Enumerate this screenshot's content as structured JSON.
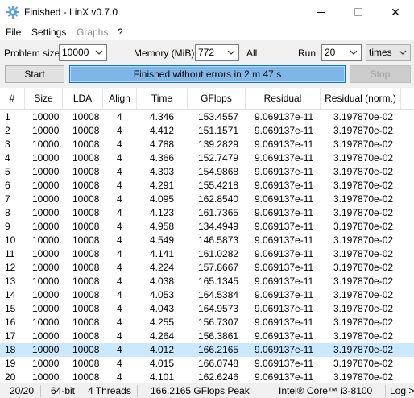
{
  "window": {
    "title": "Finished - LinX v0.7.0",
    "close_glyph": "✕"
  },
  "menu": {
    "file": "File",
    "settings": "Settings",
    "graphs": "Graphs",
    "help": "?"
  },
  "controls": {
    "problem_size_label": "Problem size:",
    "problem_size_value": "10000",
    "memory_label": "Memory (MiB):",
    "memory_value": "772",
    "all_label": "All",
    "run_label": "Run:",
    "run_value": "20",
    "run_unit": "times",
    "start_button": "Start",
    "stop_button": "Stop",
    "progress_text": "Finished without errors in 2 m 47 s",
    "progress_fraction": 1.0
  },
  "table": {
    "columns": [
      "#",
      "Size",
      "LDA",
      "Align",
      "Time",
      "GFlops",
      "Residual",
      "Residual (norm.)"
    ],
    "selected_row_index": 17,
    "rows": [
      [
        "1",
        "10000",
        "10008",
        "4",
        "4.346",
        "153.4557",
        "9.069137e-11",
        "3.197870e-02"
      ],
      [
        "2",
        "10000",
        "10008",
        "4",
        "4.412",
        "151.1571",
        "9.069137e-11",
        "3.197870e-02"
      ],
      [
        "3",
        "10000",
        "10008",
        "4",
        "4.788",
        "139.2829",
        "9.069137e-11",
        "3.197870e-02"
      ],
      [
        "4",
        "10000",
        "10008",
        "4",
        "4.366",
        "152.7479",
        "9.069137e-11",
        "3.197870e-02"
      ],
      [
        "5",
        "10000",
        "10008",
        "4",
        "4.303",
        "154.9868",
        "9.069137e-11",
        "3.197870e-02"
      ],
      [
        "6",
        "10000",
        "10008",
        "4",
        "4.291",
        "155.4218",
        "9.069137e-11",
        "3.197870e-02"
      ],
      [
        "7",
        "10000",
        "10008",
        "4",
        "4.095",
        "162.8540",
        "9.069137e-11",
        "3.197870e-02"
      ],
      [
        "8",
        "10000",
        "10008",
        "4",
        "4.123",
        "161.7365",
        "9.069137e-11",
        "3.197870e-02"
      ],
      [
        "9",
        "10000",
        "10008",
        "4",
        "4.958",
        "134.4949",
        "9.069137e-11",
        "3.197870e-02"
      ],
      [
        "10",
        "10000",
        "10008",
        "4",
        "4.549",
        "146.5873",
        "9.069137e-11",
        "3.197870e-02"
      ],
      [
        "11",
        "10000",
        "10008",
        "4",
        "4.141",
        "161.0282",
        "9.069137e-11",
        "3.197870e-02"
      ],
      [
        "12",
        "10000",
        "10008",
        "4",
        "4.224",
        "157.8667",
        "9.069137e-11",
        "3.197870e-02"
      ],
      [
        "13",
        "10000",
        "10008",
        "4",
        "4.038",
        "165.1345",
        "9.069137e-11",
        "3.197870e-02"
      ],
      [
        "14",
        "10000",
        "10008",
        "4",
        "4.053",
        "164.5384",
        "9.069137e-11",
        "3.197870e-02"
      ],
      [
        "15",
        "10000",
        "10008",
        "4",
        "4.043",
        "164.9573",
        "9.069137e-11",
        "3.197870e-02"
      ],
      [
        "16",
        "10000",
        "10008",
        "4",
        "4.255",
        "156.7307",
        "9.069137e-11",
        "3.197870e-02"
      ],
      [
        "17",
        "10000",
        "10008",
        "4",
        "4.264",
        "156.3861",
        "9.069137e-11",
        "3.197870e-02"
      ],
      [
        "18",
        "10000",
        "10008",
        "4",
        "4.012",
        "166.2165",
        "9.069137e-11",
        "3.197870e-02"
      ],
      [
        "19",
        "10000",
        "10008",
        "4",
        "4.015",
        "166.0748",
        "9.069137e-11",
        "3.197870e-02"
      ],
      [
        "20",
        "10000",
        "10008",
        "4",
        "4.101",
        "162.6246",
        "9.069137e-11",
        "3.197870e-02"
      ]
    ]
  },
  "status": {
    "progress": "20/20",
    "bits": "64-bit",
    "threads": "4 Threads",
    "peak": "166.2165 GFlops Peak",
    "cpu": "Intel® Core™ i3-8100",
    "log": "Log >"
  },
  "colors": {
    "accent": "#0078d7",
    "progress_bg": "#7fb6e8",
    "selected_row": "#cce8ff"
  },
  "icons": {
    "app": "linx-gear-icon",
    "dropdown": "chevron-down-icon"
  }
}
